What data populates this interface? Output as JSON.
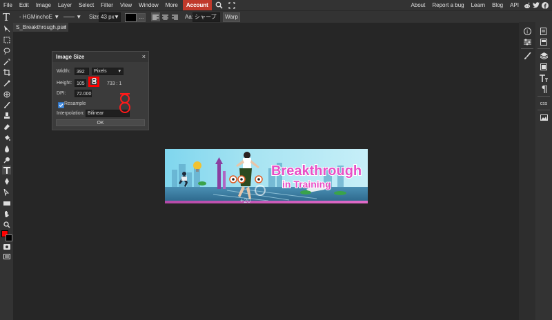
{
  "menu": {
    "items": [
      "File",
      "Edit",
      "Image",
      "Layer",
      "Select",
      "Filter",
      "View",
      "Window",
      "More"
    ],
    "account": "Account",
    "right_links": [
      "About",
      "Report a bug",
      "Learn",
      "Blog",
      "API"
    ],
    "social_icons": [
      "reddit-icon",
      "twitter-icon",
      "facebook-icon"
    ]
  },
  "options": {
    "tool_icon": "T",
    "font": "- HGMinchoE ▼",
    "style": "—— ▼",
    "size_label": "Size:",
    "size_value": "43 px",
    "size_drop": "▼",
    "dots": "...",
    "aa_label": "Aa:",
    "aa_value": "シャープ",
    "warp": "Warp"
  },
  "doc_tab": {
    "name": "S_Breakthrough.psd",
    "close": "×"
  },
  "dialog": {
    "title": "Image Size",
    "close": "×",
    "width_label": "Width:",
    "width_value": "392",
    "unit": "Pixels",
    "height_label": "Height:",
    "height_value": "105",
    "ratio": "733 : 1",
    "dpi_label": "DPI:",
    "dpi_value": "72.000",
    "resample_label": "Resample",
    "resample_checked": true,
    "interp_label": "Interpolation:",
    "interp_value": "Bilinear",
    "ok": "OK"
  },
  "canvas_image": {
    "line1": "Breakthrough",
    "line2": "in Training",
    "overlay_text": "+20"
  },
  "right_panel": {
    "css": "css"
  },
  "colors": {
    "accent": "#c0392b",
    "foreground": "#ff0000",
    "background": "#000000"
  }
}
